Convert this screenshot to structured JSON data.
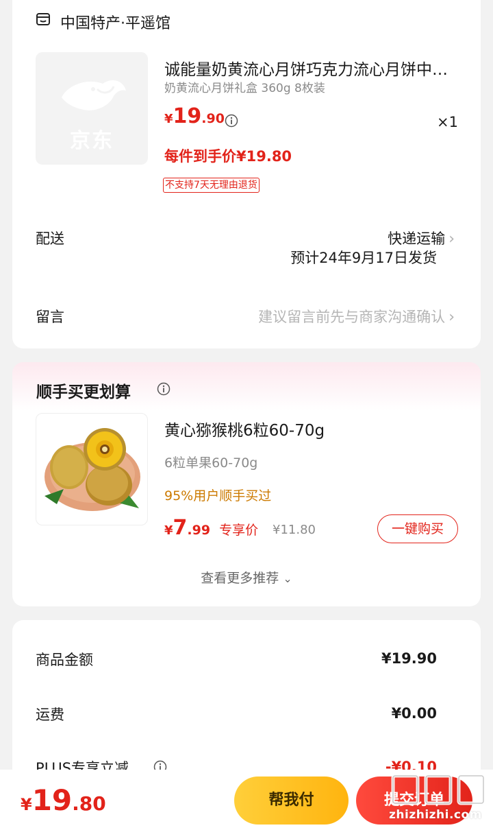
{
  "shop": {
    "name": "中国特产·平遥馆",
    "icon": "store-icon"
  },
  "product": {
    "thumb_text": "京东",
    "title": "诚能量奶黄流心月饼巧克力流心月饼中秋节月饼礼盒",
    "spec": "奶黄流心月饼礼盒 360g 8枚装",
    "currency": "¥",
    "price_int": "19",
    "price_dec": ".90",
    "qty": "×1",
    "final_price": "每件到手价¥19.80",
    "tag": "不支持7天无理由退货"
  },
  "delivery": {
    "label": "配送",
    "method": "快递运输",
    "eta": "预计24年9月17日发货"
  },
  "message": {
    "label": "留言",
    "placeholder": "建议留言前先与商家沟通确认"
  },
  "recommend": {
    "title": "顺手买更划算",
    "item": {
      "title": "黄心猕猴桃6粒60-70g",
      "spec": "6粒单果60-70g",
      "social": "95%用户顺手买过",
      "currency": "¥",
      "price_int": "7",
      "price_dec": ".99",
      "price_label": "专享价",
      "orig_price": "¥11.80",
      "buy_label": "一键购买"
    },
    "more": "查看更多推荐"
  },
  "summary": {
    "goods_label": "商品金额",
    "goods_value": "¥19.90",
    "shipping_label": "运费",
    "shipping_value": "¥0.00",
    "plus_label": "PLUS专享立减",
    "plus_value": "-¥0.10"
  },
  "bottom": {
    "currency": "¥",
    "total_int": "19",
    "total_dec": ".80",
    "help_pay": "帮我付",
    "submit": "提交订单"
  },
  "watermark": {
    "text": "zhizhizhi.com",
    "logo_text": "值值值"
  },
  "colors": {
    "accent_red": "#e2231a",
    "gold": "#ffc21f",
    "orange_text": "#cc7a00"
  }
}
